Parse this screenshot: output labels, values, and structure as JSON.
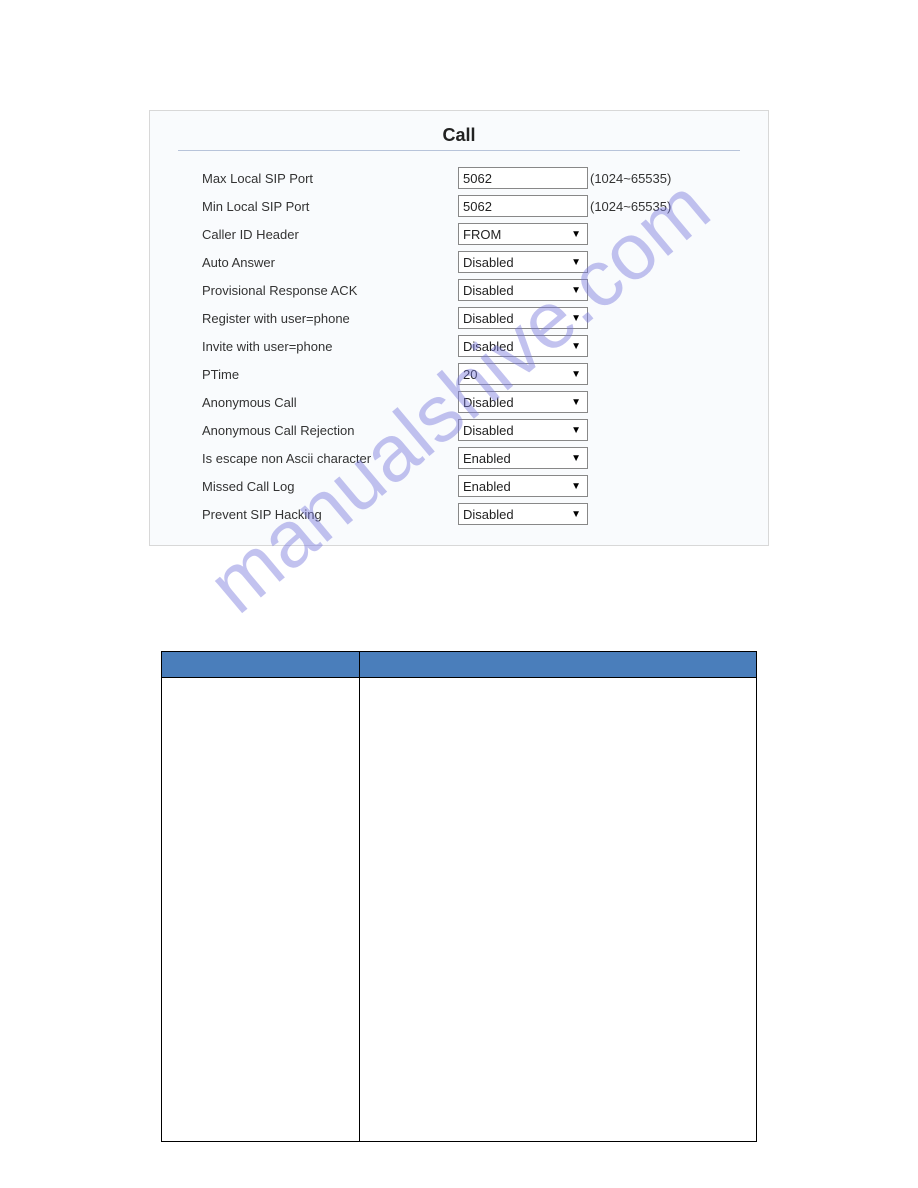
{
  "panel": {
    "title": "Call",
    "rows": [
      {
        "label": "Max Local SIP Port",
        "type": "text",
        "value": "5062",
        "hint": "(1024~65535)"
      },
      {
        "label": "Min Local SIP Port",
        "type": "text",
        "value": "5062",
        "hint": "(1024~65535)"
      },
      {
        "label": "Caller ID Header",
        "type": "select",
        "value": "FROM"
      },
      {
        "label": "Auto Answer",
        "type": "select",
        "value": "Disabled"
      },
      {
        "label": "Provisional Response ACK",
        "type": "select",
        "value": "Disabled"
      },
      {
        "label": "Register with user=phone",
        "type": "select",
        "value": "Disabled"
      },
      {
        "label": "Invite with user=phone",
        "type": "select",
        "value": "Disabled"
      },
      {
        "label": "PTime",
        "type": "select",
        "value": "20"
      },
      {
        "label": "Anonymous Call",
        "type": "select",
        "value": "Disabled"
      },
      {
        "label": "Anonymous Call Rejection",
        "type": "select",
        "value": "Disabled"
      },
      {
        "label": "Is escape non Ascii character",
        "type": "select",
        "value": "Enabled"
      },
      {
        "label": "Missed Call Log",
        "type": "select",
        "value": "Enabled"
      },
      {
        "label": "Prevent SIP Hacking",
        "type": "select",
        "value": "Disabled"
      }
    ]
  },
  "watermark": "manualshive.com"
}
